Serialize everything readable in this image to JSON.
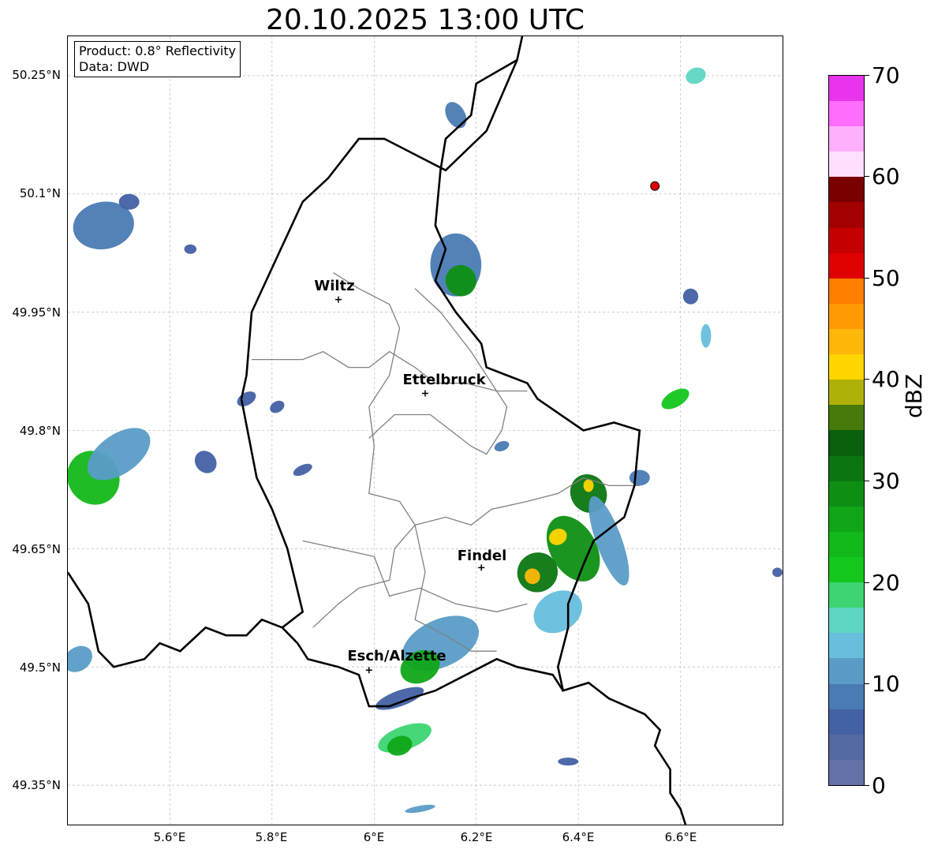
{
  "title": "20.10.2025 13:00 UTC",
  "info": {
    "product": "Product: 0.8° Reflectivity",
    "data": "Data: DWD"
  },
  "lat_ticks": [
    "50.25°N",
    "50.1°N",
    "49.95°N",
    "49.8°N",
    "49.65°N",
    "49.5°N",
    "49.35°N"
  ],
  "lon_ticks": [
    "5.6°E",
    "5.8°E",
    "6°E",
    "6.2°E",
    "6.4°E",
    "6.6°E"
  ],
  "cities": [
    {
      "name": "Wiltz",
      "lon": 5.93,
      "lat": 49.966
    },
    {
      "name": "Ettelbruck",
      "lon": 6.1,
      "lat": 49.847
    },
    {
      "name": "Findel",
      "lon": 6.21,
      "lat": 49.626
    },
    {
      "name": "Esch/Alzette",
      "lon": 5.99,
      "lat": 49.496
    }
  ],
  "extent": {
    "lon_min": 5.4,
    "lon_max": 6.8,
    "lat_min": 49.3,
    "lat_max": 50.3
  },
  "radar_marker": {
    "lon": 6.55,
    "lat": 50.11,
    "color": "#e00000"
  },
  "colorbar": {
    "unit": "dBZ",
    "tick_labels": [
      "0",
      "10",
      "20",
      "30",
      "40",
      "50",
      "60",
      "70"
    ],
    "min": 0,
    "max": 70,
    "colors": [
      "#6371a8",
      "#546aa3",
      "#4461a5",
      "#4a7bb5",
      "#5a9cc7",
      "#67bfdd",
      "#5fd6c3",
      "#3cd571",
      "#13c71c",
      "#13b81a",
      "#10a618",
      "#0e8f14",
      "#0b7611",
      "#0a5f0d",
      "#467a0a",
      "#afb108",
      "#ffd600",
      "#ffb70a",
      "#ff9a05",
      "#ff7f00",
      "#e00000",
      "#c40000",
      "#a30000",
      "#7a0000",
      "#ffdefe",
      "#ffb0fd",
      "#ff6dfc",
      "#e834ed"
    ]
  },
  "reflectivity_cells": [
    {
      "lon": 5.47,
      "lat": 50.06,
      "rlon": 0.06,
      "rlat": 0.03,
      "dbz": 8,
      "rot": -10
    },
    {
      "lon": 5.45,
      "lat": 49.74,
      "rlon": 0.05,
      "rlat": 0.035,
      "dbz": 24,
      "rot": -35
    },
    {
      "lon": 5.5,
      "lat": 49.77,
      "rlon": 0.07,
      "rlat": 0.025,
      "dbz": 12,
      "rot": -35
    },
    {
      "lon": 5.42,
      "lat": 49.51,
      "rlon": 0.03,
      "rlat": 0.015,
      "dbz": 12,
      "rot": -35
    },
    {
      "lon": 5.67,
      "lat": 49.76,
      "rlon": 0.02,
      "rlat": 0.015,
      "dbz": 6,
      "rot": -40
    },
    {
      "lon": 5.64,
      "lat": 50.03,
      "rlon": 0.012,
      "rlat": 0.006,
      "dbz": 6,
      "rot": 0
    },
    {
      "lon": 5.75,
      "lat": 49.84,
      "rlon": 0.02,
      "rlat": 0.008,
      "dbz": 6,
      "rot": -30
    },
    {
      "lon": 5.81,
      "lat": 49.83,
      "rlon": 0.015,
      "rlat": 0.007,
      "dbz": 6,
      "rot": -30
    },
    {
      "lon": 5.86,
      "lat": 49.75,
      "rlon": 0.02,
      "rlat": 0.006,
      "dbz": 6,
      "rot": -25
    },
    {
      "lon": 5.52,
      "lat": 50.09,
      "rlon": 0.02,
      "rlat": 0.01,
      "dbz": 6,
      "rot": 0
    },
    {
      "lon": 6.16,
      "lat": 50.01,
      "rlon": 0.05,
      "rlat": 0.04,
      "dbz": 8,
      "rot": 0
    },
    {
      "lon": 6.17,
      "lat": 49.99,
      "rlon": 0.03,
      "rlat": 0.02,
      "dbz": 28,
      "rot": -25
    },
    {
      "lon": 6.16,
      "lat": 50.2,
      "rlon": 0.018,
      "rlat": 0.018,
      "dbz": 8,
      "rot": -30
    },
    {
      "lon": 6.42,
      "lat": 49.72,
      "rlon": 0.035,
      "rlat": 0.025,
      "dbz": 30,
      "rot": -30
    },
    {
      "lon": 6.39,
      "lat": 49.65,
      "rlon": 0.045,
      "rlat": 0.045,
      "dbz": 28,
      "rot": -30
    },
    {
      "lon": 6.32,
      "lat": 49.62,
      "rlon": 0.04,
      "rlat": 0.025,
      "dbz": 30,
      "rot": -30
    },
    {
      "lon": 6.36,
      "lat": 49.57,
      "rlon": 0.05,
      "rlat": 0.025,
      "dbz": 14,
      "rot": -30
    },
    {
      "lon": 6.46,
      "lat": 49.66,
      "rlon": 0.025,
      "rlat": 0.06,
      "dbz": 10,
      "rot": -20
    },
    {
      "lon": 6.36,
      "lat": 49.665,
      "rlon": 0.018,
      "rlat": 0.01,
      "dbz": 42,
      "rot": -30
    },
    {
      "lon": 6.31,
      "lat": 49.615,
      "rlon": 0.015,
      "rlat": 0.01,
      "dbz": 44,
      "rot": -30
    },
    {
      "lon": 6.42,
      "lat": 49.73,
      "rlon": 0.01,
      "rlat": 0.008,
      "dbz": 41,
      "rot": 0
    },
    {
      "lon": 6.13,
      "lat": 49.53,
      "rlon": 0.08,
      "rlat": 0.03,
      "dbz": 12,
      "rot": -25
    },
    {
      "lon": 6.09,
      "lat": 49.5,
      "rlon": 0.04,
      "rlat": 0.02,
      "dbz": 25,
      "rot": -25
    },
    {
      "lon": 6.06,
      "lat": 49.41,
      "rlon": 0.055,
      "rlat": 0.015,
      "dbz": 18,
      "rot": -20
    },
    {
      "lon": 6.05,
      "lat": 49.4,
      "rlon": 0.025,
      "rlat": 0.012,
      "dbz": 25,
      "rot": -20
    },
    {
      "lon": 6.05,
      "lat": 49.46,
      "rlon": 0.05,
      "rlat": 0.01,
      "dbz": 6,
      "rot": -20
    },
    {
      "lon": 6.59,
      "lat": 49.84,
      "rlon": 0.03,
      "rlat": 0.01,
      "dbz": 20,
      "rot": -30
    },
    {
      "lon": 6.63,
      "lat": 50.25,
      "rlon": 0.02,
      "rlat": 0.01,
      "dbz": 16,
      "rot": -20
    },
    {
      "lon": 6.62,
      "lat": 49.97,
      "rlon": 0.015,
      "rlat": 0.01,
      "dbz": 6,
      "rot": 0
    },
    {
      "lon": 6.65,
      "lat": 49.92,
      "rlon": 0.01,
      "rlat": 0.015,
      "dbz": 14,
      "rot": 0
    },
    {
      "lon": 6.52,
      "lat": 49.74,
      "rlon": 0.02,
      "rlat": 0.01,
      "dbz": 8,
      "rot": 0
    },
    {
      "lon": 6.25,
      "lat": 49.78,
      "rlon": 0.015,
      "rlat": 0.006,
      "dbz": 8,
      "rot": -20
    },
    {
      "lon": 6.38,
      "lat": 49.38,
      "rlon": 0.02,
      "rlat": 0.005,
      "dbz": 6,
      "rot": 0
    },
    {
      "lon": 6.09,
      "lat": 49.32,
      "rlon": 0.03,
      "rlat": 0.004,
      "dbz": 10,
      "rot": -10
    },
    {
      "lon": 6.79,
      "lat": 49.62,
      "rlon": 0.01,
      "rlat": 0.006,
      "dbz": 6,
      "rot": 0
    }
  ],
  "boundaries": {
    "country": [
      [
        [
          6.29,
          50.3
        ],
        [
          6.28,
          50.27
        ],
        [
          6.2,
          50.24
        ],
        [
          6.19,
          50.2
        ],
        [
          6.14,
          50.17
        ],
        [
          6.13,
          50.13
        ],
        [
          6.12,
          50.06
        ],
        [
          6.14,
          50.03
        ],
        [
          6.12,
          49.99
        ],
        [
          6.16,
          49.95
        ],
        [
          6.21,
          49.91
        ],
        [
          6.22,
          49.88
        ],
        [
          6.3,
          49.86
        ],
        [
          6.32,
          49.84
        ],
        [
          6.41,
          49.8
        ],
        [
          6.47,
          49.81
        ],
        [
          6.52,
          49.8
        ],
        [
          6.51,
          49.73
        ],
        [
          6.49,
          49.69
        ],
        [
          6.43,
          49.66
        ],
        [
          6.41,
          49.63
        ],
        [
          6.38,
          49.58
        ],
        [
          6.38,
          49.55
        ],
        [
          6.36,
          49.5
        ],
        [
          6.37,
          49.47
        ],
        [
          6.42,
          49.48
        ],
        [
          6.46,
          49.46
        ],
        [
          6.53,
          49.44
        ],
        [
          6.56,
          49.42
        ],
        [
          6.55,
          49.4
        ],
        [
          6.58,
          49.37
        ],
        [
          6.58,
          49.34
        ],
        [
          6.6,
          49.32
        ],
        [
          6.61,
          49.3
        ]
      ],
      [
        [
          5.4,
          49.62
        ],
        [
          5.44,
          49.58
        ],
        [
          5.46,
          49.52
        ],
        [
          5.49,
          49.5
        ],
        [
          5.55,
          49.51
        ],
        [
          5.58,
          49.53
        ],
        [
          5.62,
          49.52
        ],
        [
          5.67,
          49.55
        ],
        [
          5.71,
          49.54
        ],
        [
          5.75,
          49.54
        ],
        [
          5.78,
          49.56
        ],
        [
          5.82,
          49.55
        ],
        [
          5.85,
          49.53
        ],
        [
          5.87,
          49.51
        ],
        [
          5.93,
          49.5
        ],
        [
          5.97,
          49.49
        ],
        [
          5.98,
          49.47
        ],
        [
          5.99,
          49.45
        ],
        [
          6.03,
          49.45
        ],
        [
          6.07,
          49.46
        ],
        [
          6.12,
          49.47
        ],
        [
          6.18,
          49.49
        ],
        [
          6.24,
          49.51
        ],
        [
          6.28,
          49.5
        ],
        [
          6.35,
          49.49
        ],
        [
          6.37,
          49.47
        ]
      ],
      [
        [
          6.28,
          50.27
        ],
        [
          6.22,
          50.18
        ],
        [
          6.14,
          50.13
        ],
        [
          6.02,
          50.17
        ],
        [
          5.97,
          50.17
        ],
        [
          5.91,
          50.12
        ],
        [
          5.86,
          50.09
        ],
        [
          5.81,
          50.02
        ],
        [
          5.76,
          49.95
        ],
        [
          5.75,
          49.87
        ],
        [
          5.74,
          49.84
        ],
        [
          5.77,
          49.74
        ],
        [
          5.8,
          49.7
        ],
        [
          5.83,
          49.65
        ],
        [
          5.86,
          49.57
        ],
        [
          5.82,
          49.55
        ]
      ]
    ],
    "cantons": [
      [
        [
          5.76,
          49.89
        ],
        [
          5.82,
          49.89
        ],
        [
          5.86,
          49.89
        ],
        [
          5.9,
          49.9
        ],
        [
          5.95,
          49.88
        ],
        [
          5.99,
          49.88
        ],
        [
          6.03,
          49.9
        ],
        [
          6.08,
          49.88
        ],
        [
          6.12,
          49.86
        ],
        [
          6.18,
          49.86
        ],
        [
          6.24,
          49.85
        ],
        [
          6.3,
          49.85
        ]
      ],
      [
        [
          5.92,
          50.0
        ],
        [
          5.97,
          49.98
        ],
        [
          6.03,
          49.96
        ],
        [
          6.05,
          49.93
        ],
        [
          6.03,
          49.87
        ],
        [
          5.99,
          49.83
        ],
        [
          6.0,
          49.78
        ],
        [
          5.99,
          49.72
        ],
        [
          6.05,
          49.71
        ],
        [
          6.08,
          49.68
        ],
        [
          6.14,
          49.69
        ],
        [
          6.19,
          49.68
        ],
        [
          6.23,
          49.7
        ],
        [
          6.3,
          49.71
        ],
        [
          6.36,
          49.72
        ],
        [
          6.41,
          49.74
        ],
        [
          6.46,
          49.73
        ],
        [
          6.52,
          49.73
        ]
      ],
      [
        [
          6.08,
          49.98
        ],
        [
          6.13,
          49.95
        ],
        [
          6.19,
          49.9
        ],
        [
          6.23,
          49.86
        ],
        [
          6.26,
          49.83
        ],
        [
          6.25,
          49.8
        ],
        [
          6.22,
          49.77
        ],
        [
          6.19,
          49.78
        ],
        [
          6.11,
          49.82
        ],
        [
          6.04,
          49.82
        ],
        [
          5.99,
          49.79
        ]
      ],
      [
        [
          5.86,
          49.66
        ],
        [
          5.93,
          49.65
        ],
        [
          6.0,
          49.64
        ],
        [
          6.03,
          49.59
        ],
        [
          6.09,
          49.6
        ],
        [
          6.16,
          49.58
        ],
        [
          6.24,
          49.57
        ],
        [
          6.3,
          49.58
        ]
      ],
      [
        [
          6.08,
          49.68
        ],
        [
          6.1,
          49.62
        ],
        [
          6.08,
          49.56
        ],
        [
          6.14,
          49.54
        ],
        [
          6.19,
          49.52
        ],
        [
          6.24,
          49.52
        ]
      ],
      [
        [
          5.88,
          49.55
        ],
        [
          5.93,
          49.58
        ],
        [
          5.97,
          49.6
        ],
        [
          6.03,
          49.61
        ],
        [
          6.04,
          49.65
        ],
        [
          6.08,
          49.68
        ]
      ]
    ]
  }
}
